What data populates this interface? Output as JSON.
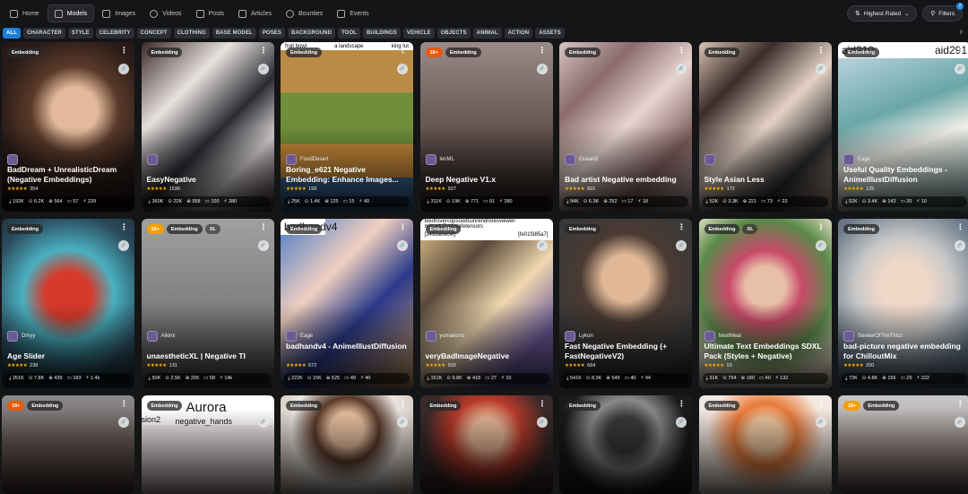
{
  "nav": [
    {
      "label": "Home",
      "icon": "home-icon"
    },
    {
      "label": "Models",
      "icon": "grid-icon",
      "active": true
    },
    {
      "label": "Images",
      "icon": "image-icon"
    },
    {
      "label": "Videos",
      "icon": "video-icon"
    },
    {
      "label": "Posts",
      "icon": "posts-icon"
    },
    {
      "label": "Articles",
      "icon": "article-icon"
    },
    {
      "label": "Bounties",
      "icon": "bounty-icon"
    },
    {
      "label": "Events",
      "icon": "calendar-icon"
    }
  ],
  "sort_label": "Highest Rated",
  "filters_label": "Filters",
  "filters_count": "2",
  "categories": [
    "ALL",
    "CHARACTER",
    "STYLE",
    "CELEBRITY",
    "CONCEPT",
    "CLOTHING",
    "BASE MODEL",
    "POSES",
    "BACKGROUND",
    "TOOL",
    "BUILDINGS",
    "VEHICLE",
    "OBJECTS",
    "ANIMAL",
    "ACTION",
    "ASSETS"
  ],
  "cards": [
    {
      "tags": [
        "Embedding"
      ],
      "creator": "",
      "title": "BadDream + UnrealisticDream (Negative Embeddings)",
      "rating": "354",
      "stats": [
        "192K",
        "6.2K",
        "564",
        "57",
        "239"
      ]
    },
    {
      "tags": [
        "Embedding"
      ],
      "creator": "",
      "title": "EasyNegative",
      "rating": "1536",
      "stats": [
        "360K",
        "22K",
        "958",
        "100",
        "380"
      ]
    },
    {
      "tags": [
        "Embedding"
      ],
      "creator": "FoodDesert",
      "title": "Boring_e621 Negative Embedding: Enhance Images...",
      "rating": "159",
      "stats": [
        "25K",
        "1.4K",
        "125",
        "15",
        "40"
      ],
      "overlay_left": "fruit bowl",
      "overlay_mid": "a landscape",
      "overlay_right": "king tut"
    },
    {
      "tags": [
        "18+",
        "Embedding"
      ],
      "creator": "lenML",
      "title": "Deep Negative V1.x",
      "rating": "927",
      "stats": [
        "311K",
        "19K",
        "771",
        "91",
        "380"
      ]
    },
    {
      "tags": [
        "Embedding"
      ],
      "creator": "Ocean3",
      "title": "Bad artist Negative embedding",
      "rating": "601",
      "stats": [
        "94K",
        "6.3K",
        "252",
        "17",
        "18"
      ]
    },
    {
      "tags": [
        "Embedding"
      ],
      "creator": "",
      "title": "Style Asian Less",
      "rating": "172",
      "stats": [
        "52K",
        "3.3K",
        "221",
        "73",
        "23"
      ]
    },
    {
      "tags": [
        "Embedding"
      ],
      "creator": "Eage",
      "title": "Useful Quality Embeddings - AnimeIllustDiffusion",
      "rating": "125",
      "stats": [
        "52K",
        "3.4K",
        "143",
        "20",
        "10"
      ],
      "overlay_left": "aid210",
      "overlay_right": "aid291",
      "xl": "XL"
    },
    {
      "tags": [
        "Embedding"
      ],
      "creator": "Dmyy",
      "title": "Age Slider",
      "rating": "238",
      "stats": [
        "261K",
        "7.8K",
        "439",
        "183",
        "1.4k"
      ]
    },
    {
      "tags": [
        "18+",
        "Embedding",
        "XL"
      ],
      "creator": "Aikimi",
      "title": "unaestheticXL | Negative TI",
      "rating": "131",
      "stats": [
        "50K",
        "2.5K",
        "205",
        "58",
        "14k"
      ]
    },
    {
      "tags": [
        "Embedding"
      ],
      "creator": "Eage",
      "title": "badhandv4 - AnimeIllustDiffusion",
      "rating": "672",
      "stats": [
        "222K",
        "15K",
        "625",
        "49",
        "40"
      ],
      "overlay_left": "badhandv4"
    },
    {
      "tags": [
        "Embedding"
      ],
      "creator": "yumakono",
      "title": "veryBadImageNegative",
      "rating": "503",
      "stats": [
        "151K",
        "9.8K",
        "418",
        "27",
        "10"
      ],
      "overlay_left": "[3493a0ec4f]",
      "overlay_right": "[fe01f385a7]",
      "overlay_top": "boutrovercopsoodsunrendroresviewer-mix_v1.7_r1.safetensors"
    },
    {
      "tags": [
        "Embedding"
      ],
      "creator": "Lykon",
      "title": "Fast Negative Embedding (+ FastNegativeV2)",
      "rating": "664",
      "stats": [
        "541K",
        "8.3K",
        "549",
        "40",
        "44"
      ]
    },
    {
      "tags": [
        "Embedding",
        "XL"
      ],
      "creator": "NextMeal",
      "title": "Ultimate Text Embeddings SDXL Pack (Styles + Negative)",
      "rating": "93",
      "stats": [
        "31K",
        "754",
        "180",
        "40",
        "132"
      ]
    },
    {
      "tags": [
        "Embedding"
      ],
      "creator": "SeekerOfTheThicc",
      "title": "bad-picture negative embedding for ChilloutMix",
      "rating": "200",
      "stats": [
        "73K",
        "4.8K",
        "156",
        "29",
        "222"
      ]
    },
    {
      "tags": [
        "18+",
        "Embedding"
      ],
      "creator": "",
      "title": "",
      "rating": "",
      "stats": []
    },
    {
      "tags": [
        "Embedding"
      ],
      "creator": "",
      "title": "",
      "rating": "",
      "stats": [],
      "overlay_left": "sion2",
      "overlay_top": "Aurora",
      "overlay_mid": "negative_hands"
    },
    {
      "tags": [
        "Embedding"
      ],
      "creator": "",
      "title": "",
      "rating": "",
      "stats": []
    },
    {
      "tags": [
        "Embedding"
      ],
      "creator": "",
      "title": "",
      "rating": "",
      "stats": []
    },
    {
      "tags": [
        "Embedding"
      ],
      "creator": "",
      "title": "",
      "rating": "",
      "stats": []
    },
    {
      "tags": [
        "Embedding"
      ],
      "creator": "",
      "title": "",
      "rating": "",
      "stats": []
    },
    {
      "tags": [
        "18+",
        "Embedding"
      ],
      "creator": "",
      "title": "",
      "rating": "",
      "stats": []
    }
  ],
  "stars": "★★★★★"
}
